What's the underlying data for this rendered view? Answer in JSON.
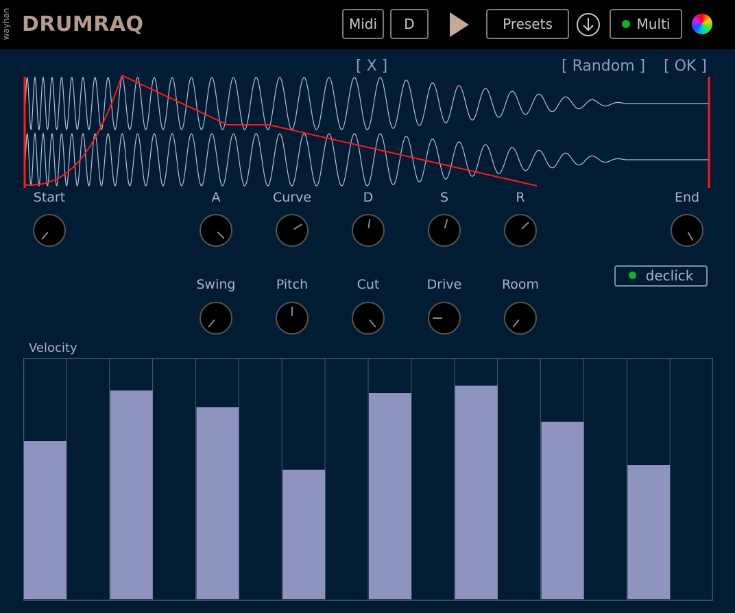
{
  "header": {
    "vendor": "wayhan",
    "logo": "DRUMRAQ",
    "midi_label": "Midi",
    "d_label": "D",
    "play_icon": "play-icon",
    "presets_label": "Presets",
    "download_icon": "download-icon",
    "multi_label": "Multi",
    "multi_led": "#10b12a",
    "color_wheel_icon": "color-wheel-icon"
  },
  "editor": {
    "close_label": "[ X ]",
    "random_label": "[ Random ]",
    "ok_label": "[ OK ]"
  },
  "knobs_row1": [
    {
      "label": "Start",
      "angle": -140
    },
    {
      "label": "A",
      "angle": 135
    },
    {
      "label": "Curve",
      "angle": 58
    },
    {
      "label": "D",
      "angle": 8
    },
    {
      "label": "S",
      "angle": 15
    },
    {
      "label": "R",
      "angle": 45
    },
    {
      "label": "End",
      "angle": 150
    }
  ],
  "knobs_row2": [
    {
      "label": "Swing",
      "angle": -140
    },
    {
      "label": "Pitch",
      "angle": 0
    },
    {
      "label": "Cut",
      "angle": 140
    },
    {
      "label": "Drive",
      "angle": -90
    },
    {
      "label": "Room",
      "angle": -140
    }
  ],
  "declick": {
    "label": "declick",
    "led": "#10b12a"
  },
  "velocity": {
    "title": "Velocity",
    "values": [
      0.66,
      0.87,
      0.8,
      0.54,
      0.86,
      0.89,
      0.74,
      0.56
    ],
    "bar_color": "#8e93bf",
    "grid_color": "#4d5a68"
  },
  "colors": {
    "background": "#021d33",
    "waveform": "#b7bedc",
    "envelope": "#ff1a1a"
  }
}
